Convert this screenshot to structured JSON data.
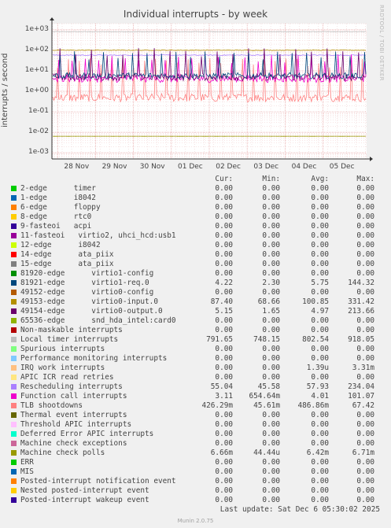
{
  "title": "Individual interrupts - by week",
  "side_label": "RRDTOOL / TOBI OETIKER",
  "footer": "Munin 2.0.75",
  "last_update": "Last update: Sat Dec  6 05:30:02 2025",
  "legend_header": {
    "cur": "Cur:",
    "min": "Min:",
    "avg": "Avg:",
    "max": "Max:"
  },
  "chart_data": {
    "type": "line",
    "title": "Individual interrupts - by week",
    "ylabel": "interrupts / second",
    "xlabel": "",
    "y_scale": "log",
    "ylim": [
      0.0005,
      2000
    ],
    "y_ticks": [
      "1e+03",
      "1e+02",
      "1e+01",
      "1e+00",
      "1e-01",
      "1e-02",
      "1e-03"
    ],
    "y_tick_values": [
      1000,
      100,
      10,
      1,
      0.1,
      0.01,
      0.001
    ],
    "x_ticks": [
      "28 Nov",
      "29 Nov",
      "30 Nov",
      "01 Dec",
      "02 Dec",
      "03 Dec",
      "04 Dec",
      "05 Dec"
    ],
    "x_range_days": 8.3,
    "grid": true,
    "series": [
      {
        "name": "2-edge      timer",
        "color": "#00cc00",
        "cur": "0.00",
        "min": "0.00",
        "avg": "0.00",
        "max": "0.00"
      },
      {
        "name": "1-edge      i8042",
        "color": "#0066b3",
        "cur": "0.00",
        "min": "0.00",
        "avg": "0.00",
        "max": "0.00"
      },
      {
        "name": "6-edge      floppy",
        "color": "#ff8000",
        "cur": "0.00",
        "min": "0.00",
        "avg": "0.00",
        "max": "0.00"
      },
      {
        "name": "8-edge      rtc0",
        "color": "#ffcc00",
        "cur": "0.00",
        "min": "0.00",
        "avg": "0.00",
        "max": "0.00"
      },
      {
        "name": "9-fasteoi   acpi",
        "color": "#330099",
        "cur": "0.00",
        "min": "0.00",
        "avg": "0.00",
        "max": "0.00"
      },
      {
        "name": "11-fasteoi   virtio2, uhci_hcd:usb1",
        "color": "#990099",
        "cur": "0.00",
        "min": "0.00",
        "avg": "0.00",
        "max": "0.00"
      },
      {
        "name": "12-edge      i8042",
        "color": "#ccff00",
        "cur": "0.00",
        "min": "0.00",
        "avg": "0.00",
        "max": "0.00"
      },
      {
        "name": "14-edge      ata_piix",
        "color": "#ff0000",
        "cur": "0.00",
        "min": "0.00",
        "avg": "0.00",
        "max": "0.00"
      },
      {
        "name": "15-edge      ata_piix",
        "color": "#808080",
        "cur": "0.00",
        "min": "0.00",
        "avg": "0.00",
        "max": "0.00"
      },
      {
        "name": "81920-edge      virtio1-config",
        "color": "#008f00",
        "cur": "0.00",
        "min": "0.00",
        "avg": "0.00",
        "max": "0.00"
      },
      {
        "name": "81921-edge      virtio1-req.0",
        "color": "#00487d",
        "cur": "4.22",
        "min": "2.30",
        "avg": "5.75",
        "max": "144.32"
      },
      {
        "name": "49152-edge      virtio0-config",
        "color": "#b35a00",
        "cur": "0.00",
        "min": "0.00",
        "avg": "0.00",
        "max": "0.00"
      },
      {
        "name": "49153-edge      virtio0-input.0",
        "color": "#b38f00",
        "cur": "87.40",
        "min": "68.66",
        "avg": "100.85",
        "max": "331.42"
      },
      {
        "name": "49154-edge      virtio0-output.0",
        "color": "#6b006b",
        "cur": "5.15",
        "min": "1.65",
        "avg": "4.97",
        "max": "213.66"
      },
      {
        "name": "65536-edge      snd_hda_intel:card0",
        "color": "#8fb300",
        "cur": "0.00",
        "min": "0.00",
        "avg": "0.00",
        "max": "0.00"
      },
      {
        "name": "Non-maskable interrupts",
        "color": "#b30000",
        "cur": "0.00",
        "min": "0.00",
        "avg": "0.00",
        "max": "0.00"
      },
      {
        "name": "Local timer interrupts",
        "color": "#bebebe",
        "cur": "791.65",
        "min": "748.15",
        "avg": "802.54",
        "max": "918.05"
      },
      {
        "name": "Spurious interrupts",
        "color": "#80ff80",
        "cur": "0.00",
        "min": "0.00",
        "avg": "0.00",
        "max": "0.00"
      },
      {
        "name": "Performance monitoring interrupts",
        "color": "#80c9ff",
        "cur": "0.00",
        "min": "0.00",
        "avg": "0.00",
        "max": "0.00"
      },
      {
        "name": "IRQ work interrupts",
        "color": "#ffc080",
        "cur": "0.00",
        "min": "0.00",
        "avg": "1.39u",
        "max": "3.31m"
      },
      {
        "name": "APIC ICR read retries",
        "color": "#ffe680",
        "cur": "0.00",
        "min": "0.00",
        "avg": "0.00",
        "max": "0.00"
      },
      {
        "name": "Rescheduling interrupts",
        "color": "#aa80ff",
        "cur": "55.04",
        "min": "45.58",
        "avg": "57.93",
        "max": "234.04"
      },
      {
        "name": "Function call interrupts",
        "color": "#ee00cc",
        "cur": "3.11",
        "min": "654.64m",
        "avg": "4.01",
        "max": "101.07"
      },
      {
        "name": "TLB shootdowns",
        "color": "#ff8080",
        "cur": "426.29m",
        "min": "45.61m",
        "avg": "486.86m",
        "max": "67.42"
      },
      {
        "name": "Thermal event interrupts",
        "color": "#666600",
        "cur": "0.00",
        "min": "0.00",
        "avg": "0.00",
        "max": "0.00"
      },
      {
        "name": "Threshold APIC interrupts",
        "color": "#ffbfff",
        "cur": "0.00",
        "min": "0.00",
        "avg": "0.00",
        "max": "0.00"
      },
      {
        "name": "Deferred Error APIC interrupts",
        "color": "#00ffcc",
        "cur": "0.00",
        "min": "0.00",
        "avg": "0.00",
        "max": "0.00"
      },
      {
        "name": "Machine check exceptions",
        "color": "#cc6699",
        "cur": "0.00",
        "min": "0.00",
        "avg": "0.00",
        "max": "0.00"
      },
      {
        "name": "Machine check polls",
        "color": "#999900",
        "cur": "6.66m",
        "min": "44.44u",
        "avg": "6.42m",
        "max": "6.71m"
      },
      {
        "name": "ERR",
        "color": "#00cc00",
        "cur": "0.00",
        "min": "0.00",
        "avg": "0.00",
        "max": "0.00"
      },
      {
        "name": "MIS",
        "color": "#0066b3",
        "cur": "0.00",
        "min": "0.00",
        "avg": "0.00",
        "max": "0.00"
      },
      {
        "name": "Posted-interrupt notification event",
        "color": "#ff8000",
        "cur": "0.00",
        "min": "0.00",
        "avg": "0.00",
        "max": "0.00"
      },
      {
        "name": "Nested posted-interrupt event",
        "color": "#ffcc00",
        "cur": "0.00",
        "min": "0.00",
        "avg": "0.00",
        "max": "0.00"
      },
      {
        "name": "Posted-interrupt wakeup event",
        "color": "#330099",
        "cur": "0.00",
        "min": "0.00",
        "avg": "0.00",
        "max": "0.00"
      }
    ]
  }
}
